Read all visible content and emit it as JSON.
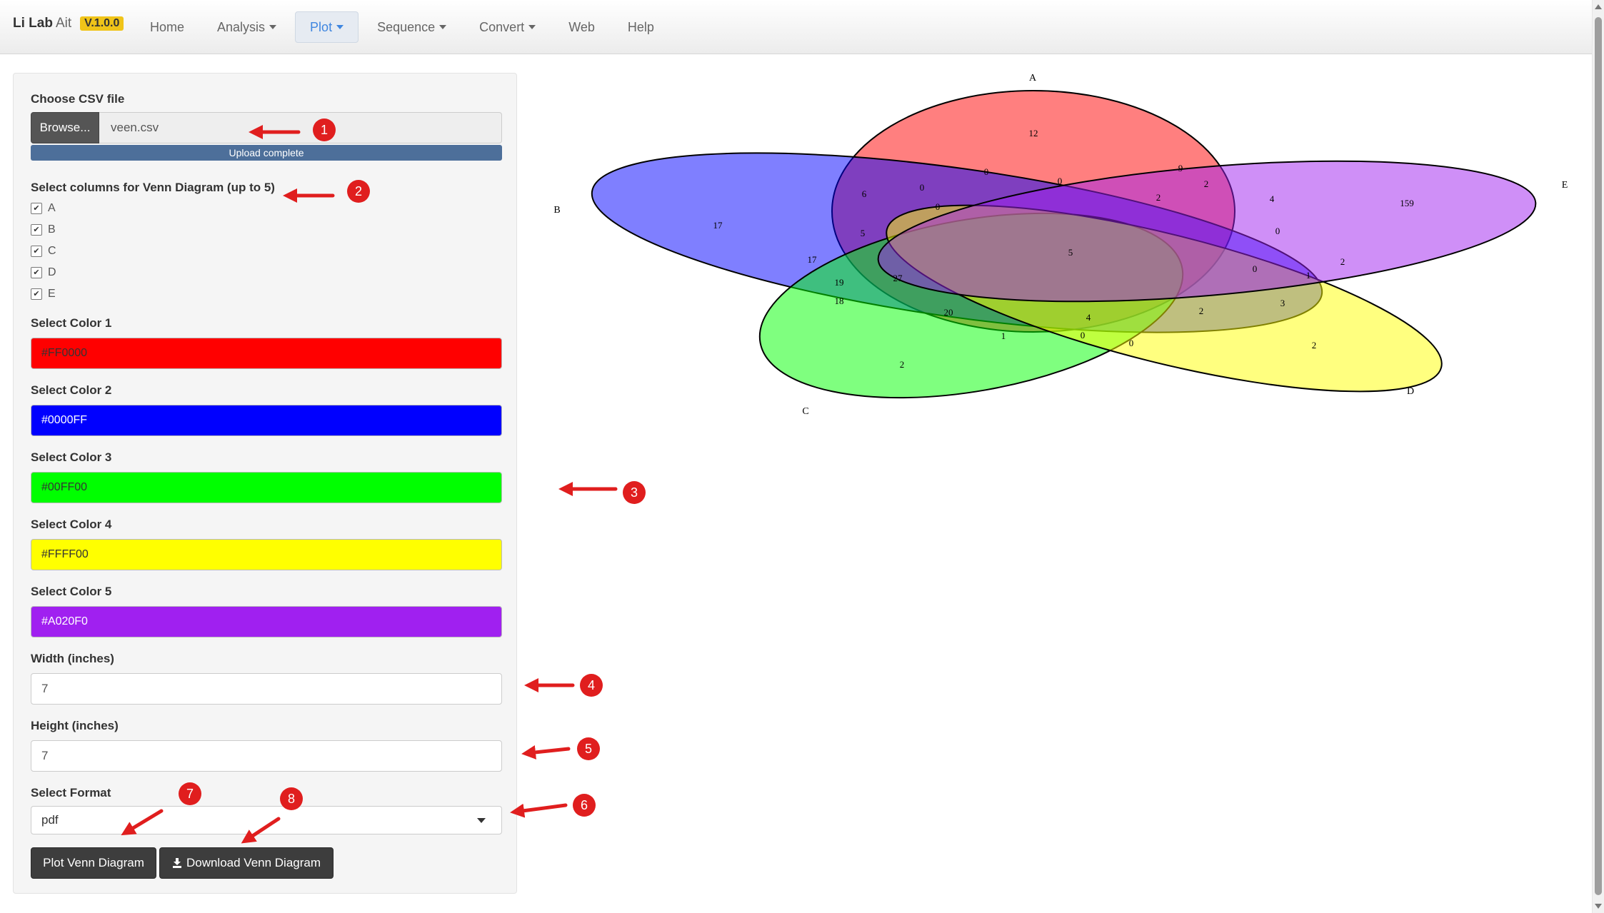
{
  "navbar": {
    "brand_main": "Li Lab",
    "brand_sub": "Ait",
    "version": "V.1.0.0",
    "items": [
      {
        "label": "Home",
        "dropdown": false
      },
      {
        "label": "Analysis",
        "dropdown": true
      },
      {
        "label": "Plot",
        "dropdown": true,
        "active": true
      },
      {
        "label": "Sequence",
        "dropdown": true
      },
      {
        "label": "Convert",
        "dropdown": true
      },
      {
        "label": "Web",
        "dropdown": false
      },
      {
        "label": "Help",
        "dropdown": false
      }
    ]
  },
  "form": {
    "file_label": "Choose CSV file",
    "browse_label": "Browse...",
    "file_name": "veen.csv",
    "upload_status": "Upload complete",
    "columns_label": "Select columns for Venn Diagram (up to 5)",
    "columns": [
      {
        "label": "A",
        "checked": true
      },
      {
        "label": "B",
        "checked": true
      },
      {
        "label": "C",
        "checked": true
      },
      {
        "label": "D",
        "checked": true
      },
      {
        "label": "E",
        "checked": true
      }
    ],
    "colors": [
      {
        "label": "Select Color 1",
        "value": "#FF0000",
        "hex": "#FF0000",
        "text_color": "#333333"
      },
      {
        "label": "Select Color 2",
        "value": "#0000FF",
        "hex": "#0000FF",
        "text_color": "#ffffff"
      },
      {
        "label": "Select Color 3",
        "value": "#00FF00",
        "hex": "#00FF00",
        "text_color": "#333333"
      },
      {
        "label": "Select Color 4",
        "value": "#FFFF00",
        "hex": "#FFFF00",
        "text_color": "#333333"
      },
      {
        "label": "Select Color 5",
        "value": "#A020F0",
        "hex": "#A020F0",
        "text_color": "#ffffff"
      }
    ],
    "width_label": "Width (inches)",
    "width_value": "7",
    "height_label": "Height (inches)",
    "height_value": "7",
    "format_label": "Select Format",
    "format_value": "pdf",
    "plot_button": "Plot Venn Diagram",
    "download_button": "Download Venn Diagram"
  },
  "venn": {
    "set_labels": [
      "A",
      "B",
      "C",
      "D",
      "E"
    ],
    "sets": [
      {
        "name": "A",
        "color": "#FF0000"
      },
      {
        "name": "B",
        "color": "#0000FF"
      },
      {
        "name": "C",
        "color": "#00FF00"
      },
      {
        "name": "D",
        "color": "#FFFF00"
      },
      {
        "name": "E",
        "color": "#A020F0"
      }
    ],
    "region_counts": [
      {
        "text": "12"
      },
      {
        "text": "0"
      },
      {
        "text": "0"
      },
      {
        "text": "0"
      },
      {
        "text": "9"
      },
      {
        "text": "2"
      },
      {
        "text": "6"
      },
      {
        "text": "0"
      },
      {
        "text": "2"
      },
      {
        "text": "4"
      },
      {
        "text": "159"
      },
      {
        "text": "17"
      },
      {
        "text": "5"
      },
      {
        "text": "0"
      },
      {
        "text": "17"
      },
      {
        "text": "5"
      },
      {
        "text": "2"
      },
      {
        "text": "0"
      },
      {
        "text": "19"
      },
      {
        "text": "27"
      },
      {
        "text": "1"
      },
      {
        "text": "18"
      },
      {
        "text": "20"
      },
      {
        "text": "3"
      },
      {
        "text": "4"
      },
      {
        "text": "2"
      },
      {
        "text": "1"
      },
      {
        "text": "0"
      },
      {
        "text": "0"
      },
      {
        "text": "2"
      },
      {
        "text": "2"
      }
    ]
  },
  "annotations": {
    "badges": [
      "1",
      "2",
      "3",
      "4",
      "5",
      "6",
      "7",
      "8"
    ],
    "arrow_color": "#e01e1e"
  }
}
